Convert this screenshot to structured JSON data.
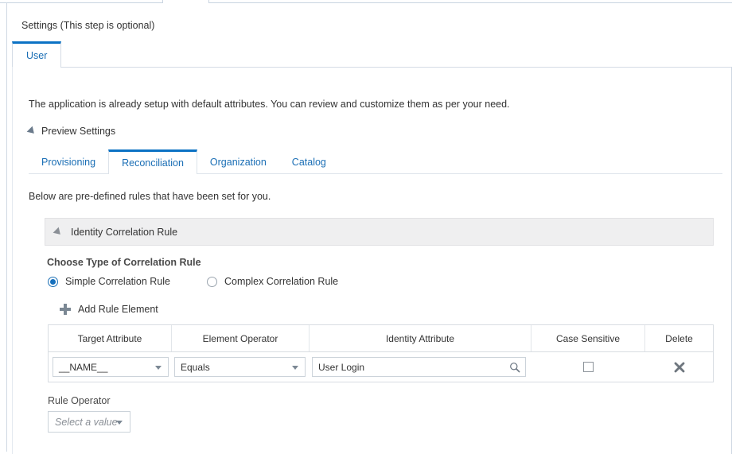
{
  "window": {
    "page_title": "Settings (This step is optional)"
  },
  "primary_tabs": [
    {
      "label": "User",
      "active": true
    }
  ],
  "body": {
    "intro_text": "The application is already setup with default attributes. You can review and customize them as per your need.",
    "preview_settings_label": "Preview Settings",
    "below_text": "Below are pre-defined rules that have been set for you."
  },
  "secondary_tabs": [
    {
      "label": "Provisioning",
      "active": false
    },
    {
      "label": "Reconciliation",
      "active": true
    },
    {
      "label": "Organization",
      "active": false
    },
    {
      "label": "Catalog",
      "active": false
    }
  ],
  "panel": {
    "header_label": "Identity Correlation Rule",
    "choose_type_label": "Choose Type of Correlation Rule",
    "radio_options": [
      {
        "label": "Simple Correlation Rule",
        "selected": true
      },
      {
        "label": "Complex Correlation Rule",
        "selected": false
      }
    ],
    "add_rule_label": "Add Rule Element"
  },
  "table": {
    "columns": [
      "Target Attribute",
      "Element Operator",
      "Identity Attribute",
      "Case Sensitive",
      "Delete"
    ],
    "rows": [
      {
        "target_attribute": "__NAME__",
        "element_operator": "Equals",
        "identity_attribute": "User Login",
        "case_sensitive_checked": false
      }
    ]
  },
  "rule_operator": {
    "label": "Rule Operator",
    "value": "Select a value"
  },
  "colors": {
    "accent_blue": "#0b72c4",
    "link_blue": "#1a6eb5",
    "panel_gray": "#efeff0",
    "border_gray": "#d8dde2",
    "icon_gray": "#7b8894",
    "text": "#333333"
  }
}
